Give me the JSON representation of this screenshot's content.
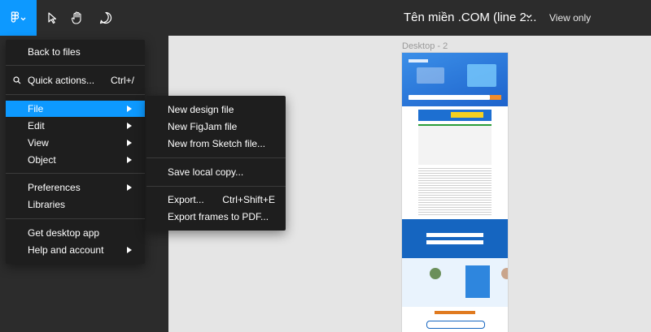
{
  "toolbar": {
    "document_title": "Tên miền .COM (line 2...",
    "view_mode": "View only",
    "brand_color": "#0d99ff",
    "icons": [
      "figma-logo-icon",
      "chevron-down-icon",
      "move-cursor-icon",
      "hand-icon",
      "comment-icon"
    ]
  },
  "canvas": {
    "frame_label": "Desktop - 2"
  },
  "main_menu": {
    "items": [
      {
        "label": "Back to files"
      },
      {
        "label": "Quick actions...",
        "shortcut": "Ctrl+/",
        "icon": "search-icon"
      },
      {
        "label": "File",
        "submenu": true,
        "active": true
      },
      {
        "label": "Edit",
        "submenu": true
      },
      {
        "label": "View",
        "submenu": true
      },
      {
        "label": "Object",
        "submenu": true
      },
      {
        "label": "Preferences",
        "submenu": true
      },
      {
        "label": "Libraries"
      },
      {
        "label": "Get desktop app"
      },
      {
        "label": "Help and account",
        "submenu": true
      }
    ]
  },
  "file_submenu": {
    "items": [
      {
        "label": "New design file"
      },
      {
        "label": "New FigJam file"
      },
      {
        "label": "New from Sketch file..."
      },
      {
        "label": "Save local copy..."
      },
      {
        "label": "Export...",
        "shortcut": "Ctrl+Shift+E"
      },
      {
        "label": "Export frames to PDF..."
      }
    ]
  }
}
